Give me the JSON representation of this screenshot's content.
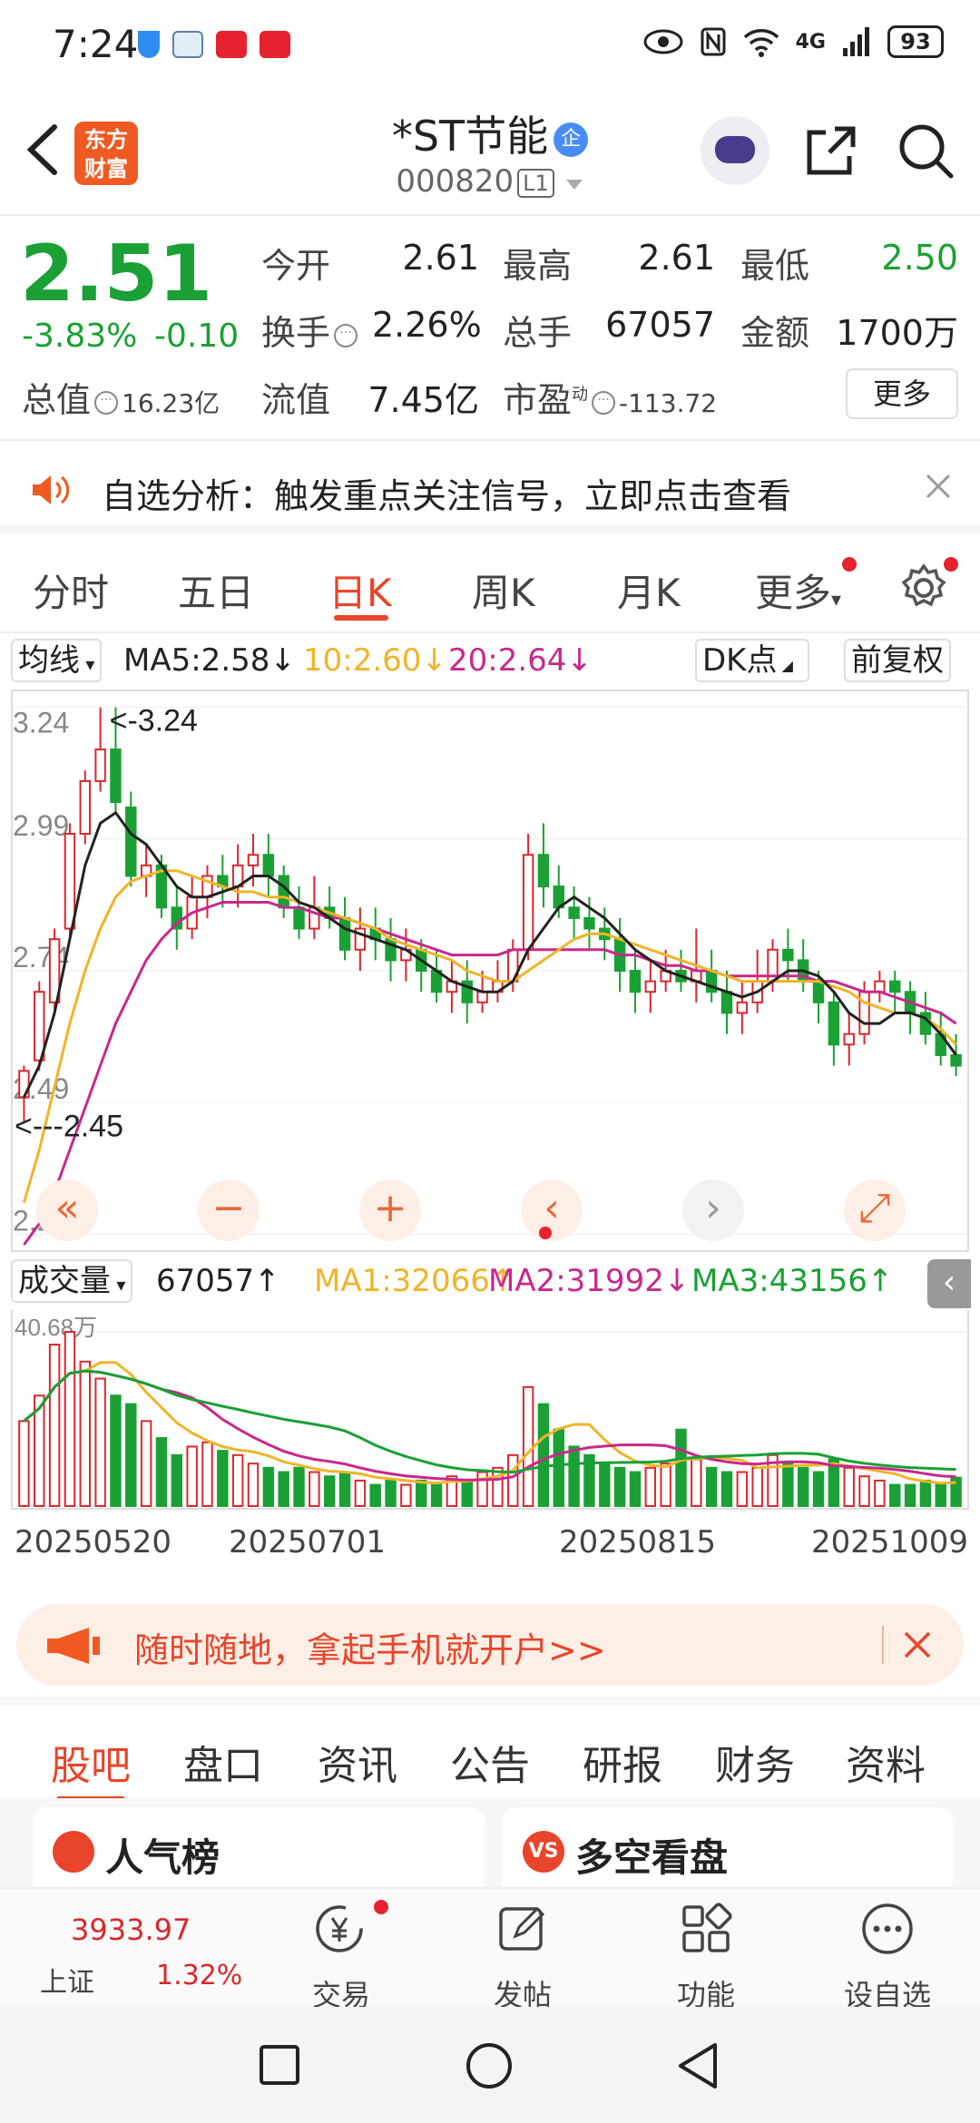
{
  "status_bar": {
    "time": "7:24",
    "signal": "4G",
    "battery": "93"
  },
  "header": {
    "logo_text": "东方财富",
    "stock_name": "*ST节能",
    "qi_badge": "企",
    "stock_code": "000820",
    "level_badge": "L1"
  },
  "quote": {
    "price": "2.51",
    "change_pct": "-3.83%",
    "change_amt": "-0.10",
    "rows": [
      {
        "l1": "今开",
        "v1": "2.61",
        "l2": "最高",
        "v2": "2.61",
        "l3": "最低",
        "v3": "2.50"
      },
      {
        "l1": "换手",
        "v1": "2.26%",
        "l2": "总手",
        "v2": "67057",
        "l3": "金额",
        "v3": "1700万"
      }
    ],
    "total_value_label": "总值",
    "total_value": "16.23亿",
    "float_value_label": "流值",
    "float_value": "7.45亿",
    "pe_label": "市盈",
    "pe_sup": "动",
    "pe_value": "-113.72",
    "more_label": "更多"
  },
  "notice": {
    "text": "自选分析：触发重点关注信号，立即点击查看"
  },
  "tabs": [
    "分时",
    "五日",
    "日K",
    "周K",
    "月K",
    "更多"
  ],
  "active_tab": "日K",
  "ma_legend": {
    "selector": "均线",
    "ma5": "MA5:2.58↓",
    "ma10": "10:2.60↓",
    "ma20": "20:2.64↓",
    "dk_button": "DK点",
    "adjust_button": "前复权"
  },
  "colors": {
    "up": "#d9272d",
    "down": "#1aa034",
    "ma5": "#222222",
    "ma10": "#f0b428",
    "ma20": "#c8288c",
    "accent": "#e8452a"
  },
  "kline": {
    "y_ticks": [
      "3.24",
      "2.99",
      "2.74",
      "2.49",
      "2.24"
    ],
    "y_values": [
      3.24,
      2.99,
      2.74,
      2.49,
      2.24
    ],
    "y_min": 2.22,
    "y_max": 3.26,
    "max_marker": "<-3.24",
    "min_marker": "<---2.45",
    "candles": [
      [
        2.5,
        2.55,
        2.45,
        2.56
      ],
      [
        2.57,
        2.7,
        2.55,
        2.72
      ],
      [
        2.68,
        2.8,
        2.66,
        2.82
      ],
      [
        2.82,
        3.0,
        2.8,
        3.02
      ],
      [
        3.0,
        3.1,
        2.98,
        3.12
      ],
      [
        3.1,
        3.16,
        3.08,
        3.24
      ],
      [
        3.16,
        3.06,
        3.04,
        3.24
      ],
      [
        3.05,
        2.92,
        2.9,
        3.08
      ],
      [
        2.92,
        2.94,
        2.88,
        2.98
      ],
      [
        2.94,
        2.86,
        2.84,
        2.96
      ],
      [
        2.86,
        2.82,
        2.78,
        2.9
      ],
      [
        2.82,
        2.88,
        2.8,
        2.92
      ],
      [
        2.88,
        2.92,
        2.84,
        2.94
      ],
      [
        2.92,
        2.9,
        2.86,
        2.96
      ],
      [
        2.9,
        2.94,
        2.86,
        2.98
      ],
      [
        2.94,
        2.96,
        2.9,
        3.0
      ],
      [
        2.96,
        2.92,
        2.88,
        3.0
      ],
      [
        2.92,
        2.86,
        2.84,
        2.94
      ],
      [
        2.86,
        2.82,
        2.8,
        2.9
      ],
      [
        2.82,
        2.86,
        2.8,
        2.92
      ],
      [
        2.86,
        2.84,
        2.82,
        2.9
      ],
      [
        2.84,
        2.78,
        2.76,
        2.88
      ],
      [
        2.78,
        2.82,
        2.74,
        2.86
      ],
      [
        2.82,
        2.8,
        2.76,
        2.86
      ],
      [
        2.8,
        2.76,
        2.72,
        2.84
      ],
      [
        2.76,
        2.78,
        2.72,
        2.82
      ],
      [
        2.78,
        2.74,
        2.7,
        2.8
      ],
      [
        2.74,
        2.7,
        2.68,
        2.78
      ],
      [
        2.7,
        2.72,
        2.66,
        2.76
      ],
      [
        2.72,
        2.68,
        2.64,
        2.76
      ],
      [
        2.68,
        2.7,
        2.66,
        2.74
      ],
      [
        2.7,
        2.72,
        2.68,
        2.76
      ],
      [
        2.72,
        2.78,
        2.7,
        2.8
      ],
      [
        2.78,
        2.96,
        2.76,
        3.0
      ],
      [
        2.96,
        2.9,
        2.86,
        3.02
      ],
      [
        2.9,
        2.86,
        2.84,
        2.94
      ],
      [
        2.86,
        2.84,
        2.8,
        2.9
      ],
      [
        2.84,
        2.82,
        2.78,
        2.88
      ],
      [
        2.82,
        2.8,
        2.76,
        2.86
      ],
      [
        2.8,
        2.74,
        2.7,
        2.84
      ],
      [
        2.74,
        2.7,
        2.66,
        2.78
      ],
      [
        2.7,
        2.72,
        2.66,
        2.76
      ],
      [
        2.72,
        2.74,
        2.7,
        2.78
      ],
      [
        2.74,
        2.72,
        2.7,
        2.78
      ],
      [
        2.72,
        2.74,
        2.68,
        2.82
      ],
      [
        2.74,
        2.7,
        2.68,
        2.78
      ],
      [
        2.7,
        2.66,
        2.62,
        2.74
      ],
      [
        2.66,
        2.68,
        2.62,
        2.72
      ],
      [
        2.68,
        2.72,
        2.66,
        2.78
      ],
      [
        2.72,
        2.78,
        2.7,
        2.8
      ],
      [
        2.78,
        2.76,
        2.72,
        2.82
      ],
      [
        2.76,
        2.72,
        2.7,
        2.8
      ],
      [
        2.72,
        2.68,
        2.64,
        2.74
      ],
      [
        2.68,
        2.6,
        2.56,
        2.7
      ],
      [
        2.6,
        2.62,
        2.56,
        2.66
      ],
      [
        2.62,
        2.7,
        2.6,
        2.72
      ],
      [
        2.7,
        2.72,
        2.68,
        2.74
      ],
      [
        2.72,
        2.7,
        2.66,
        2.74
      ],
      [
        2.7,
        2.66,
        2.62,
        2.72
      ],
      [
        2.66,
        2.62,
        2.6,
        2.7
      ],
      [
        2.62,
        2.58,
        2.56,
        2.66
      ],
      [
        2.58,
        2.56,
        2.54,
        2.62
      ]
    ],
    "ma5": [
      2.5,
      2.56,
      2.66,
      2.8,
      2.94,
      3.02,
      3.04,
      3.0,
      2.98,
      2.94,
      2.9,
      2.88,
      2.88,
      2.89,
      2.9,
      2.92,
      2.92,
      2.9,
      2.87,
      2.86,
      2.84,
      2.82,
      2.81,
      2.8,
      2.79,
      2.78,
      2.76,
      2.74,
      2.72,
      2.71,
      2.7,
      2.7,
      2.72,
      2.78,
      2.82,
      2.86,
      2.88,
      2.86,
      2.84,
      2.81,
      2.78,
      2.76,
      2.74,
      2.73,
      2.72,
      2.71,
      2.7,
      2.69,
      2.7,
      2.72,
      2.74,
      2.74,
      2.73,
      2.7,
      2.66,
      2.64,
      2.64,
      2.66,
      2.66,
      2.65,
      2.62,
      2.58
    ],
    "ma10": [
      2.3,
      2.4,
      2.52,
      2.64,
      2.74,
      2.82,
      2.88,
      2.91,
      2.92,
      2.93,
      2.93,
      2.92,
      2.91,
      2.9,
      2.89,
      2.89,
      2.88,
      2.88,
      2.87,
      2.86,
      2.85,
      2.84,
      2.83,
      2.82,
      2.8,
      2.79,
      2.78,
      2.77,
      2.76,
      2.74,
      2.73,
      2.72,
      2.72,
      2.74,
      2.76,
      2.78,
      2.8,
      2.81,
      2.81,
      2.8,
      2.79,
      2.78,
      2.77,
      2.76,
      2.75,
      2.74,
      2.73,
      2.72,
      2.72,
      2.72,
      2.72,
      2.72,
      2.72,
      2.71,
      2.7,
      2.68,
      2.67,
      2.66,
      2.66,
      2.65,
      2.63,
      2.6
    ],
    "ma20": [
      2.22,
      2.26,
      2.32,
      2.4,
      2.48,
      2.56,
      2.64,
      2.7,
      2.76,
      2.8,
      2.83,
      2.85,
      2.86,
      2.87,
      2.87,
      2.87,
      2.87,
      2.86,
      2.86,
      2.85,
      2.84,
      2.84,
      2.83,
      2.82,
      2.81,
      2.8,
      2.79,
      2.78,
      2.77,
      2.77,
      2.77,
      2.77,
      2.78,
      2.78,
      2.78,
      2.78,
      2.78,
      2.78,
      2.78,
      2.77,
      2.77,
      2.76,
      2.75,
      2.75,
      2.74,
      2.74,
      2.73,
      2.73,
      2.73,
      2.73,
      2.73,
      2.73,
      2.72,
      2.72,
      2.71,
      2.7,
      2.7,
      2.69,
      2.68,
      2.67,
      2.66,
      2.64
    ]
  },
  "volume_legend": {
    "selector": "成交量",
    "vol": "67057↑",
    "ma1": "MA1:32066↑",
    "ma2": "MA2:31992↓",
    "ma3": "MA3:43156↑"
  },
  "volume": {
    "max_label": "40.68万",
    "values": [
      20,
      26,
      38,
      41,
      34,
      30,
      26,
      24,
      20,
      16,
      12,
      14,
      15,
      13,
      12,
      10,
      9,
      8,
      9,
      8,
      7,
      8,
      6,
      5,
      6,
      5,
      6,
      5,
      7,
      6,
      8,
      9,
      12,
      28,
      24,
      18,
      14,
      12,
      10,
      9,
      8,
      9,
      10,
      18,
      11,
      9,
      8,
      8,
      9,
      12,
      10,
      9,
      8,
      11,
      9,
      7,
      6,
      5,
      5,
      6,
      5,
      6.7
    ]
  },
  "dates": [
    "20250520",
    "20250701",
    "20250815",
    "20251009"
  ],
  "account_banner": {
    "text": "随时随地，拿起手机就开户>>"
  },
  "bottom_tabs": [
    "股吧",
    "盘口",
    "资讯",
    "公告",
    "研报",
    "财务",
    "资料"
  ],
  "active_bottom_tab": "股吧",
  "cards": [
    {
      "title": "人气榜",
      "icon": "bar-chart-icon"
    },
    {
      "title": "多空看盘",
      "icon": "vs-icon"
    }
  ],
  "bottom_nav": {
    "index_value": "3933.97",
    "index_name": "上证",
    "index_change": "1.32%",
    "items": [
      "交易",
      "发帖",
      "功能",
      "设自选"
    ]
  }
}
